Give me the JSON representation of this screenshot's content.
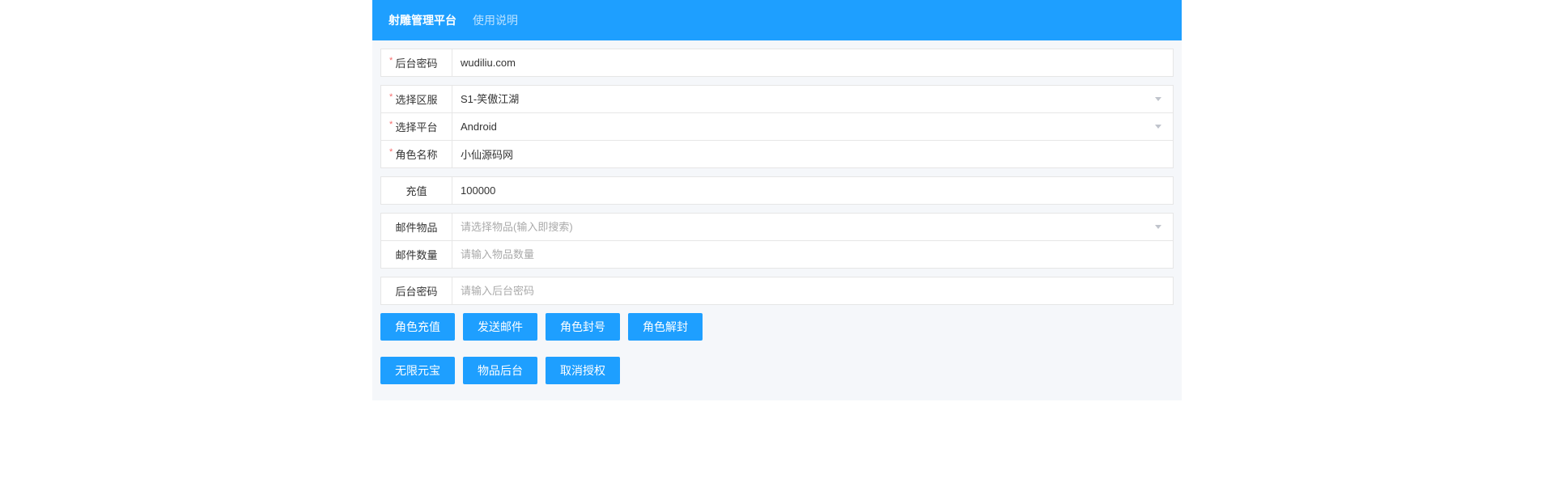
{
  "header": {
    "title": "射雕管理平台",
    "help": "使用说明"
  },
  "groups": {
    "g1": {
      "admin_password_label": "后台密码",
      "admin_password_value": "wudiliu.com"
    },
    "g2": {
      "server_label": "选择区服",
      "server_value": "S1-笑傲江湖",
      "platform_label": "选择平台",
      "platform_value": "Android",
      "role_label": "角色名称",
      "role_value": "小仙源码网"
    },
    "g3": {
      "recharge_label": "充值",
      "recharge_value": "100000"
    },
    "g4": {
      "item_label": "邮件物品",
      "item_placeholder": "请选择物品(输入即搜索)",
      "qty_label": "邮件数量",
      "qty_placeholder": "请输入物品数量"
    },
    "g5": {
      "pw_label": "后台密码",
      "pw_placeholder": "请输入后台密码"
    }
  },
  "buttons": {
    "row1": {
      "recharge": "角色充值",
      "sendmail": "发送邮件",
      "ban": "角色封号",
      "unban": "角色解封"
    },
    "row2": {
      "unlimited": "无限元宝",
      "itemadmin": "物品后台",
      "revoke": "取消授权"
    }
  }
}
